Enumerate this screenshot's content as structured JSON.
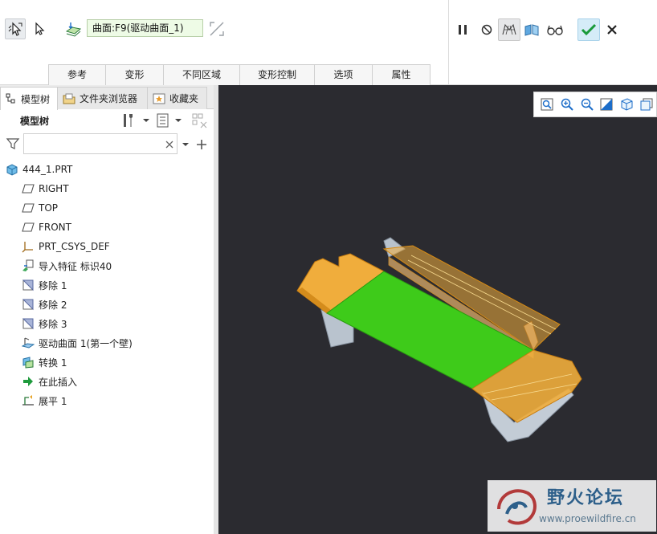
{
  "ribbon": {
    "reference_field": "曲面:F9(驱动曲面_1)",
    "tabs": [
      "参考",
      "变形",
      "不同区域",
      "变形控制",
      "选项",
      "属性"
    ]
  },
  "navigator": {
    "tabs": {
      "model_tree": "模型树",
      "folder_browser": "文件夹浏览器",
      "favorites": "收藏夹"
    },
    "tree_title": "模型树",
    "filter_placeholder": "",
    "items": [
      {
        "label": "444_1.PRT",
        "icon": "part-icon"
      },
      {
        "label": "RIGHT",
        "icon": "datum-plane-icon"
      },
      {
        "label": "TOP",
        "icon": "datum-plane-icon"
      },
      {
        "label": "FRONT",
        "icon": "datum-plane-icon"
      },
      {
        "label": "PRT_CSYS_DEF",
        "icon": "csys-icon"
      },
      {
        "label": "导入特征 标识40",
        "icon": "import-feature-icon"
      },
      {
        "label": "移除 1",
        "icon": "remove-icon"
      },
      {
        "label": "移除 2",
        "icon": "remove-icon"
      },
      {
        "label": "移除 3",
        "icon": "remove-icon"
      },
      {
        "label": "驱动曲面 1(第一个壁)",
        "icon": "driving-surface-icon"
      },
      {
        "label": "转换 1",
        "icon": "conversion-icon"
      },
      {
        "label": "在此插入",
        "icon": "insert-here-arrow-icon"
      },
      {
        "label": "展平 1",
        "icon": "flatten-icon"
      }
    ]
  },
  "watermark": {
    "title": "野火论坛",
    "url": "www.proewildfire.cn"
  },
  "colors": {
    "viewport_bg": "#2b2b30",
    "selected_surface": "#3ecb1a",
    "flange_orange": "#f0ad3c",
    "body_gray": "#c3ccd6",
    "ok_accent": "#1a9a3a"
  }
}
